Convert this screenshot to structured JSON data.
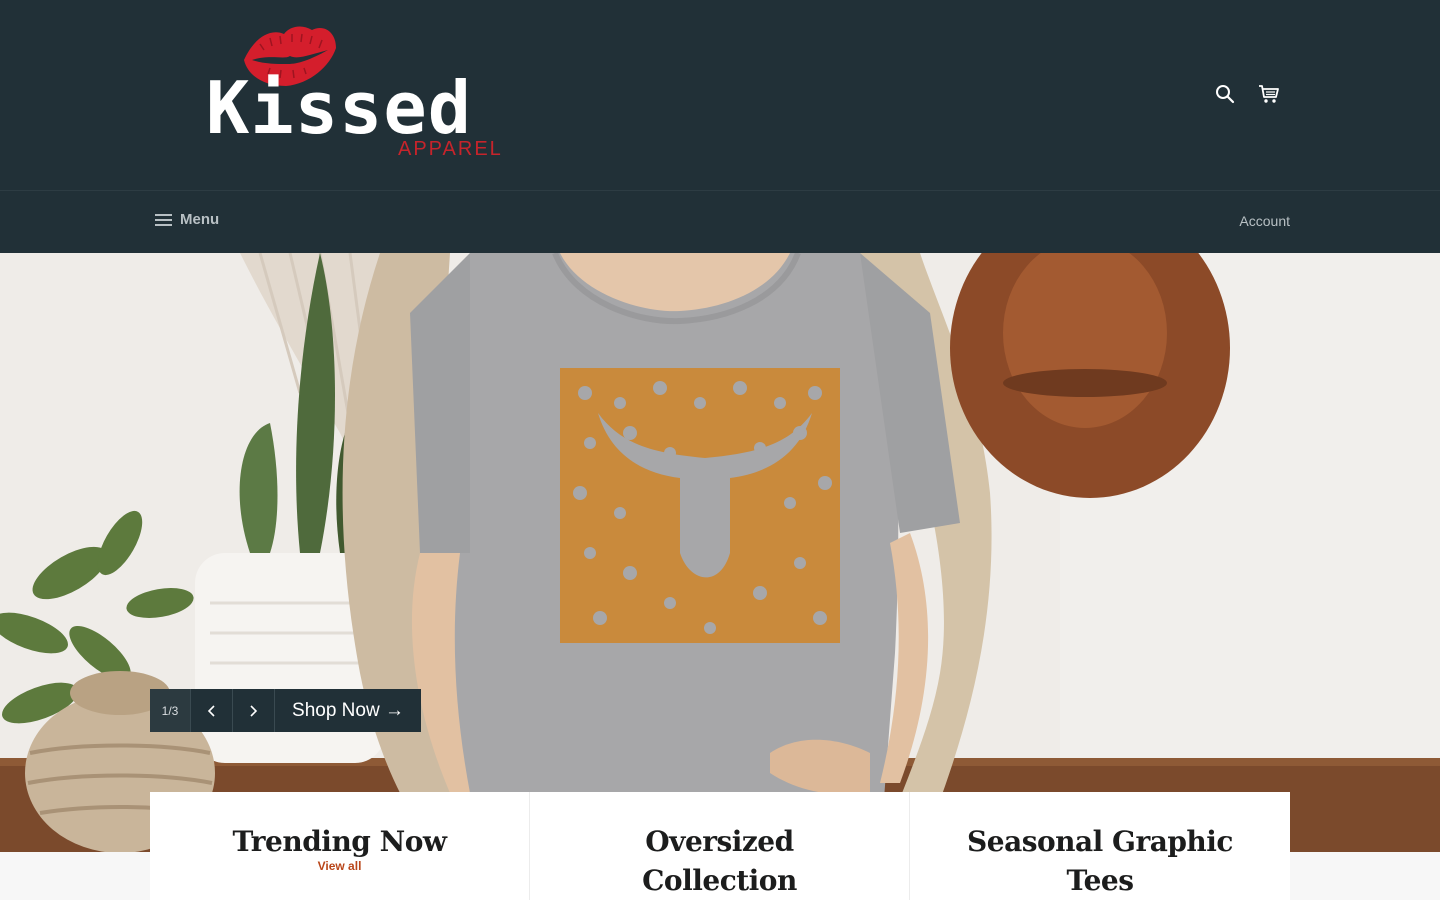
{
  "brand": {
    "name": "Kissed",
    "tagline": "APPAREL",
    "lips_color": "#d41e2c"
  },
  "header": {
    "search_icon": "search-icon",
    "cart_icon": "cart-icon"
  },
  "nav": {
    "menu_label": "Menu",
    "account_label": "Account"
  },
  "slideshow": {
    "counter": "1/3",
    "prev_icon": "chevron-left-icon",
    "next_icon": "chevron-right-icon",
    "cta_label": "Shop Now →"
  },
  "collections": [
    {
      "title": "Trending Now",
      "link": "View all"
    },
    {
      "title": "Oversized Collection",
      "link": ""
    },
    {
      "title": "Seasonal Graphic Tees",
      "link": ""
    }
  ],
  "colors": {
    "header_bg": "#213037",
    "accent": "#b9461a",
    "page_bg": "#f7f7f7"
  }
}
